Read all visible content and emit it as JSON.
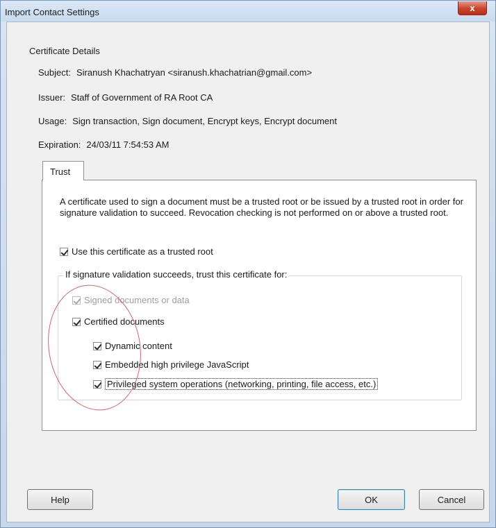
{
  "window": {
    "title": "Import Contact Settings",
    "close_label": "x"
  },
  "certificate_details": {
    "group_title": "Certificate Details",
    "subject": {
      "label": "Subject:",
      "value": "Siranush Khachatryan <siranush.khachatrian@gmail.com>"
    },
    "issuer": {
      "label": "Issuer:",
      "value": "Staff of Government of RA Root CA"
    },
    "usage": {
      "label": "Usage:",
      "value": "Sign transaction, Sign document, Encrypt keys, Encrypt document"
    },
    "expiration": {
      "label": "Expiration:",
      "value": "24/03/11 7:54:53 AM"
    }
  },
  "tabs": [
    {
      "label": "Trust"
    }
  ],
  "trust": {
    "description": "A certificate used to sign a document must be a trusted root or be issued by a trusted root in order for signature validation to succeed.  Revocation checking is not performed on or above a trusted root.",
    "use_trusted_root": {
      "label": "Use this certificate as a trusted root",
      "checked": true
    },
    "group_title": "If signature validation succeeds, trust this certificate for:",
    "options": {
      "signed_documents": {
        "label": "Signed documents or data",
        "checked": true,
        "disabled": true
      },
      "certified_documents": {
        "label": "Certified documents",
        "checked": true
      },
      "dynamic_content": {
        "label": "Dynamic content",
        "checked": true
      },
      "embedded_javascript": {
        "label": "Embedded high privilege JavaScript",
        "checked": true
      },
      "privileged_operations": {
        "label": "Privileged system operations (networking, printing, file access, etc.)",
        "checked": true
      }
    }
  },
  "buttons": {
    "help": "Help",
    "ok": "OK",
    "cancel": "Cancel"
  },
  "colors": {
    "title_bar": "#c9dbef",
    "close_button": "#c8422c",
    "annotation_circle": "#d4626c",
    "default_button_border": "#3c7fb1"
  }
}
